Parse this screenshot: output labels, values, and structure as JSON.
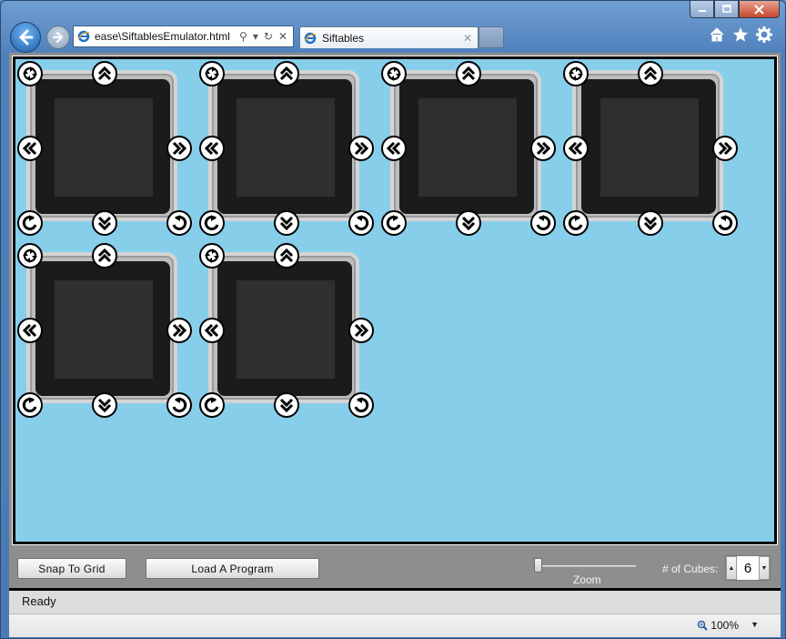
{
  "window": {
    "controls": [
      "minimize",
      "maximize",
      "close"
    ]
  },
  "browser": {
    "address_url": "ease\\SiftablesEmulator.html",
    "tab_title": "Siftables",
    "tab_close": "✕",
    "command_icons": [
      "home-icon",
      "star-icon",
      "gear-icon"
    ]
  },
  "app": {
    "cubes": [
      {
        "id": 1
      },
      {
        "id": 2
      },
      {
        "id": 3
      },
      {
        "id": 4
      },
      {
        "id": 5
      },
      {
        "id": 6
      }
    ],
    "controls": {
      "top_left": "shake-icon",
      "top": "tilt-up-icon",
      "left": "tilt-left-icon",
      "right": "tilt-right-icon",
      "bottom_left": "rotate-left-icon",
      "bottom": "tilt-down-icon",
      "bottom_right": "rotate-right-icon"
    },
    "toolbar": {
      "snap_label": "Snap To Grid",
      "load_label": "Load A Program",
      "zoom_label": "Zoom",
      "zoom_value": 0,
      "cubes_label": "# of Cubes:",
      "cubes_value": "6"
    },
    "status": "Ready"
  },
  "ie_status": {
    "zoom": "100%"
  },
  "colors": {
    "stage": "#87ceeb",
    "cube_body": "#1b1b1b",
    "cube_screen": "#2f2f2f",
    "toolbar": "#8e8e8e"
  }
}
